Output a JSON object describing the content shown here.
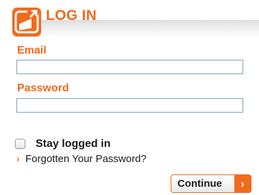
{
  "colors": {
    "accent": "#f26a1b",
    "text": "#1a1a1a",
    "input_border": "#7f9db9"
  },
  "header": {
    "title": "LOG IN",
    "icon": "log-in-door-icon"
  },
  "form": {
    "email_label": "Email",
    "email_value": "",
    "password_label": "Password",
    "password_value": "",
    "stay_logged_in_label": "Stay logged in",
    "stay_logged_in_checked": false,
    "forgot_arrow": "›",
    "forgot_link": "Forgotten Your Password?",
    "continue_label": "Continue",
    "continue_arrow": "›"
  }
}
